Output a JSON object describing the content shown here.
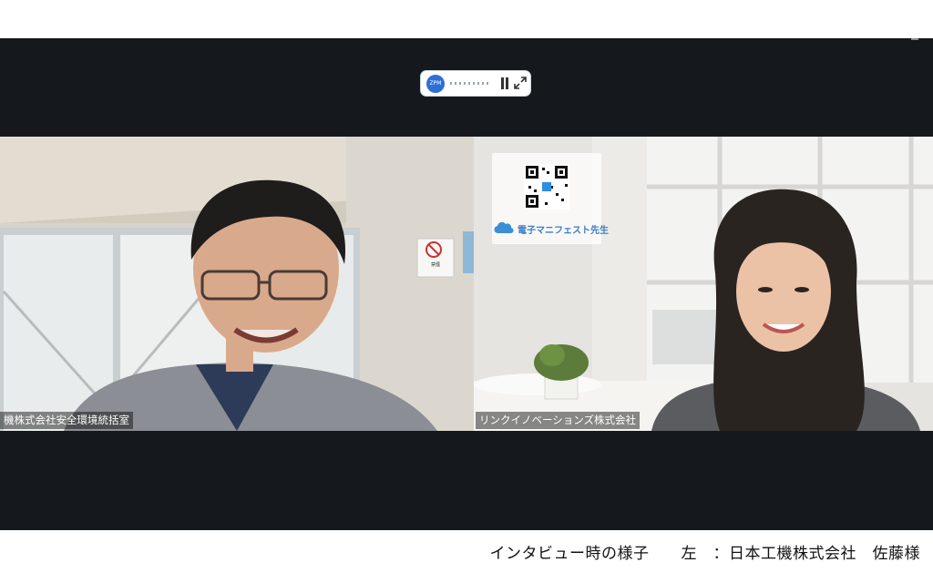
{
  "recording_controls": {
    "badge_text": "ZPM"
  },
  "participants": [
    {
      "name_label": "機株式会社安全環境統括室"
    },
    {
      "name_label": "リンクイノベーションズ株式会社"
    }
  ],
  "overlay": {
    "brand_name": "電子マニフェスト先生"
  },
  "sign": {
    "title": "禁煙"
  },
  "caption": "インタビュー時の様子　　左　：日本工機株式会社　佐藤様"
}
